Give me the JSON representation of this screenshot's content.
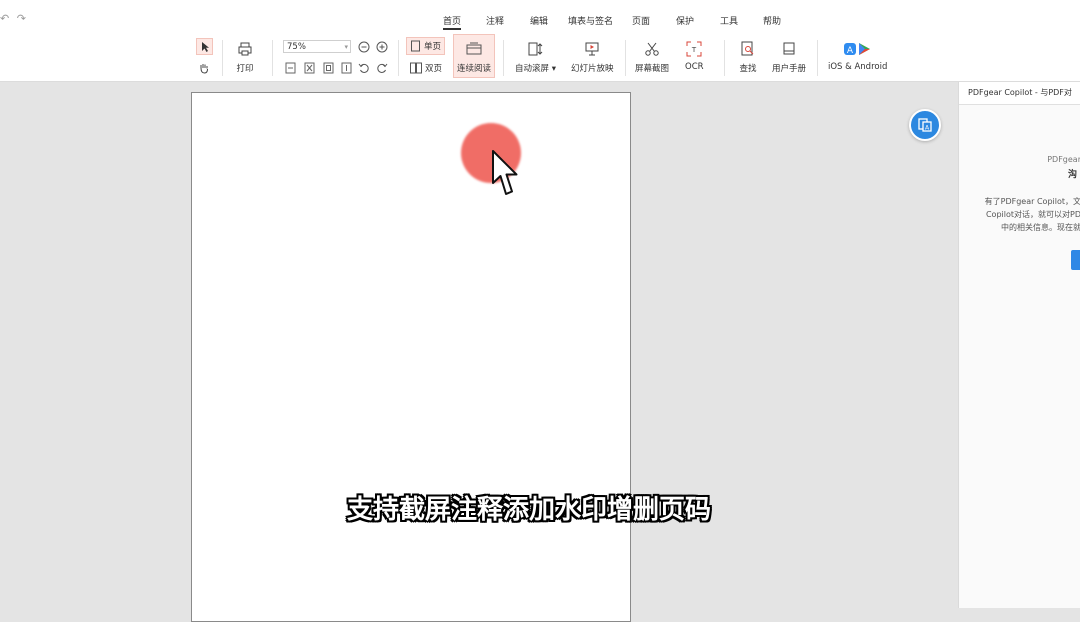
{
  "quick_access": {
    "undo_glyph": "↶",
    "redo_glyph": "↷"
  },
  "tabs": [
    {
      "label": "首页",
      "active": true
    },
    {
      "label": "注释"
    },
    {
      "label": "编辑"
    },
    {
      "label": "填表与签名"
    },
    {
      "label": "页面"
    },
    {
      "label": "保护"
    },
    {
      "label": "工具"
    },
    {
      "label": "帮助"
    }
  ],
  "toolbar": {
    "print_label": "打印",
    "zoom_value": "75%",
    "single_page_label": "单页",
    "double_page_label": "双页",
    "continuous_label": "连续阅读",
    "auto_scroll_label": "自动滚屏",
    "slideshow_label": "幻灯片放映",
    "screenshot_label": "屏幕截图",
    "ocr_label": "OCR",
    "find_label": "查找",
    "manual_label": "用户手册",
    "mobile_label": "iOS & Android"
  },
  "panel": {
    "header": "PDFgear Copilot - 与PDF对",
    "line1": "PDFgear",
    "line2": "沟",
    "desc1": "有了PDFgear Copilot，文",
    "desc2": "Copilot对话，就可以对PD",
    "desc3": "中的相关信息。现在就"
  },
  "subtitle": "支持截屏注释添加水印增删页码",
  "colors": {
    "accent": "#2c88e0",
    "click_indicator": "#ef5a52",
    "selected_bg": "#fde8e4"
  }
}
